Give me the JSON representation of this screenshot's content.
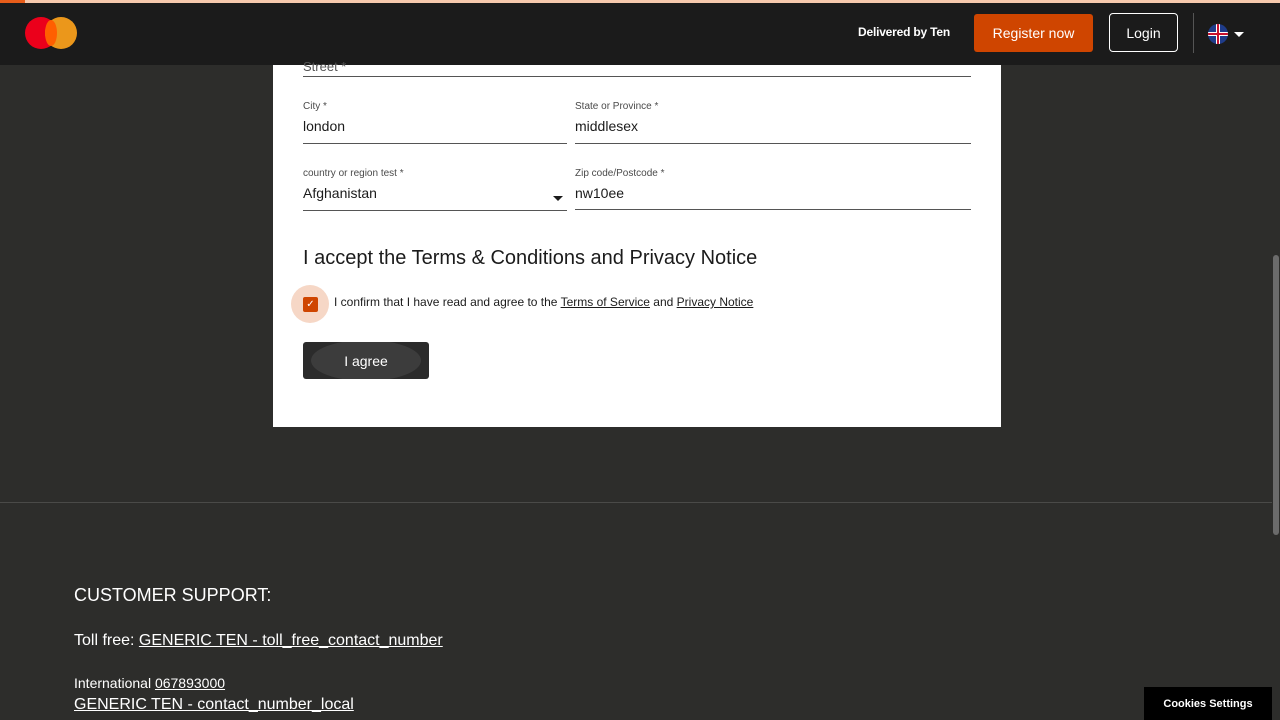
{
  "header": {
    "delivered_by": "Delivered by Ten",
    "register_label": "Register now",
    "login_label": "Login",
    "accent_color": "#cf4500"
  },
  "form": {
    "street_label": "Street *",
    "city": {
      "label": "City *",
      "value": "london"
    },
    "state": {
      "label": "State or Province *",
      "value": "middlesex"
    },
    "country": {
      "label": "country or region test *",
      "value": "Afghanistan"
    },
    "zip": {
      "label": "Zip code/Postcode *",
      "value": "nw10ee"
    },
    "terms_title": "I accept the Terms & Conditions and Privacy Notice",
    "confirm_prefix": "I confirm that I have read and agree to the ",
    "terms_link": "Terms of Service",
    "and_text": " and ",
    "privacy_link": "Privacy Notice",
    "checkbox_checked": true,
    "agree_label": "I agree"
  },
  "footer": {
    "support_title": "CUSTOMER SUPPORT:",
    "toll_free_label": "Toll free: ",
    "toll_free_link": "GENERIC TEN - toll_free_contact_number",
    "international_label": "International ",
    "international_number": "067893000",
    "local_link": "GENERIC TEN - contact_number_local"
  },
  "cookies_label": "Cookies Settings"
}
